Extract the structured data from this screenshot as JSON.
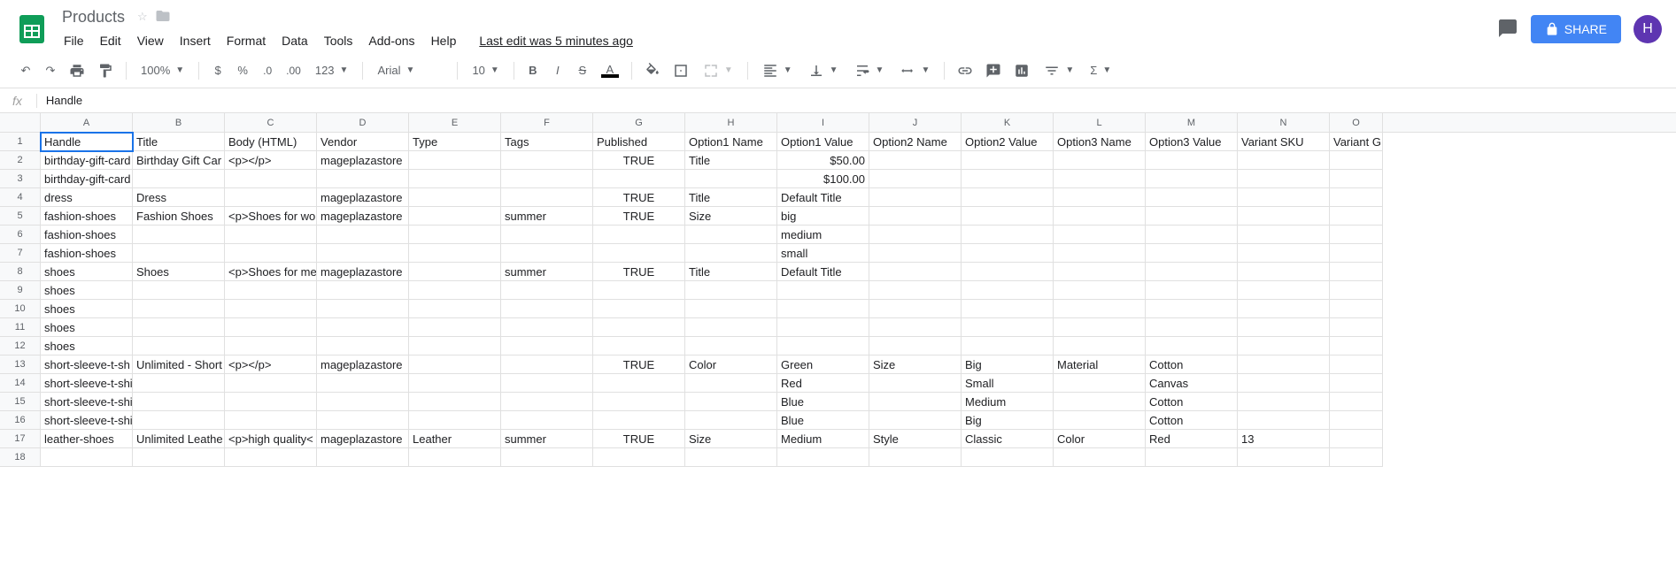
{
  "header": {
    "doc_title": "Products",
    "menus": [
      "File",
      "Edit",
      "View",
      "Insert",
      "Format",
      "Data",
      "Tools",
      "Add-ons",
      "Help"
    ],
    "last_edit": "Last edit was 5 minutes ago",
    "share_label": "SHARE",
    "avatar_letter": "H"
  },
  "toolbar": {
    "zoom": "100%",
    "font": "Arial",
    "size": "10",
    "fmt_auto": "123"
  },
  "formula": {
    "fx_label": "fx",
    "value": "Handle"
  },
  "columns": [
    "A",
    "B",
    "C",
    "D",
    "E",
    "F",
    "G",
    "H",
    "I",
    "J",
    "K",
    "L",
    "M",
    "N",
    "O"
  ],
  "selected_cell": "A1",
  "chart_data": {
    "type": "table",
    "headers": [
      "Handle",
      "Title",
      "Body (HTML)",
      "Vendor",
      "Type",
      "Tags",
      "Published",
      "Option1 Name",
      "Option1 Value",
      "Option2 Name",
      "Option2 Value",
      "Option3 Name",
      "Option3 Value",
      "Variant SKU",
      "Variant G"
    ],
    "rows": [
      [
        "birthday-gift-card",
        "Birthday Gift Car",
        "<p></p>",
        "mageplazastore",
        "",
        "",
        "TRUE",
        "Title",
        "$50.00",
        "",
        "",
        "",
        "",
        "",
        ""
      ],
      [
        "birthday-gift-card",
        "",
        "",
        "",
        "",
        "",
        "",
        "",
        "$100.00",
        "",
        "",
        "",
        "",
        "",
        ""
      ],
      [
        "dress",
        "Dress",
        "",
        "mageplazastore",
        "",
        "",
        "TRUE",
        "Title",
        "Default Title",
        "",
        "",
        "",
        "",
        "",
        ""
      ],
      [
        "fashion-shoes",
        "Fashion Shoes",
        "<p>Shoes for wo",
        "mageplazastore",
        "",
        "summer",
        "TRUE",
        "Size",
        "big",
        "",
        "",
        "",
        "",
        "",
        ""
      ],
      [
        "fashion-shoes",
        "",
        "",
        "",
        "",
        "",
        "",
        "",
        "medium",
        "",
        "",
        "",
        "",
        "",
        ""
      ],
      [
        "fashion-shoes",
        "",
        "",
        "",
        "",
        "",
        "",
        "",
        "small",
        "",
        "",
        "",
        "",
        "",
        ""
      ],
      [
        "shoes",
        "Shoes",
        "<p>Shoes for me",
        "mageplazastore",
        "",
        "summer",
        "TRUE",
        "Title",
        "Default Title",
        "",
        "",
        "",
        "",
        "",
        ""
      ],
      [
        "shoes",
        "",
        "",
        "",
        "",
        "",
        "",
        "",
        "",
        "",
        "",
        "",
        "",
        "",
        ""
      ],
      [
        "shoes",
        "",
        "",
        "",
        "",
        "",
        "",
        "",
        "",
        "",
        "",
        "",
        "",
        "",
        ""
      ],
      [
        "shoes",
        "",
        "",
        "",
        "",
        "",
        "",
        "",
        "",
        "",
        "",
        "",
        "",
        "",
        ""
      ],
      [
        "shoes",
        "",
        "",
        "",
        "",
        "",
        "",
        "",
        "",
        "",
        "",
        "",
        "",
        "",
        ""
      ],
      [
        "short-sleeve-t-sh",
        "Unlimited - Short",
        "<p></p>",
        "mageplazastore",
        "",
        "",
        "TRUE",
        "Color",
        "Green",
        "Size",
        "Big",
        "Material",
        "Cotton",
        "",
        ""
      ],
      [
        "short-sleeve-t-shirt",
        "",
        "",
        "",
        "",
        "",
        "",
        "",
        "Red",
        "",
        "Small",
        "",
        "Canvas",
        "",
        ""
      ],
      [
        "short-sleeve-t-shirt",
        "",
        "",
        "",
        "",
        "",
        "",
        "",
        "Blue",
        "",
        "Medium",
        "",
        "Cotton",
        "",
        ""
      ],
      [
        "short-sleeve-t-shirt",
        "",
        "",
        "",
        "",
        "",
        "",
        "",
        "Blue",
        "",
        "Big",
        "",
        "Cotton",
        "",
        ""
      ],
      [
        "leather-shoes",
        "Unlimited Leathe",
        "<p>high quality<",
        "mageplazastore",
        "Leather",
        "summer",
        "TRUE",
        "Size",
        "Medium",
        "Style",
        "Classic",
        "Color",
        "Red",
        "13",
        ""
      ],
      [
        "",
        "",
        "",
        "",
        "",
        "",
        "",
        "",
        "",
        "",
        "",
        "",
        "",
        "",
        ""
      ]
    ]
  }
}
